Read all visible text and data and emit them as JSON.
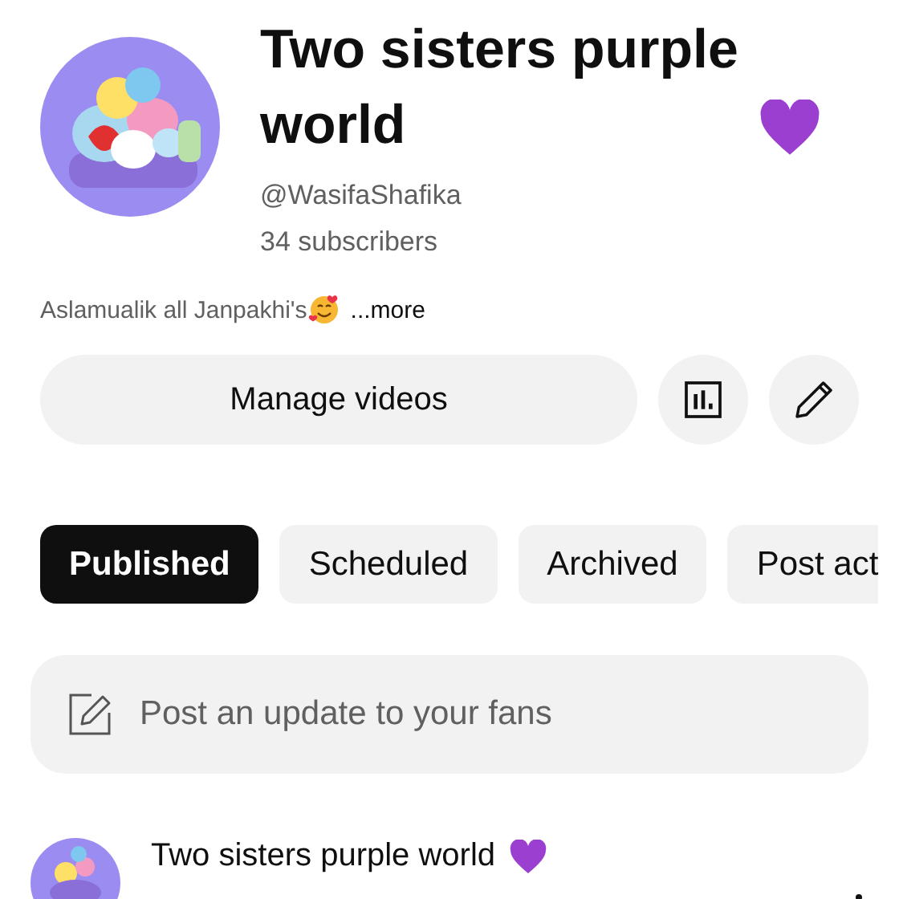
{
  "channel": {
    "title": "Two sisters purple world",
    "handle": "@WasifaShafika",
    "subscribers": "34 subscribers",
    "description": "Aslamualik all Janpakhi's",
    "more": "...more"
  },
  "actions": {
    "manage": "Manage videos"
  },
  "tabs": [
    {
      "label": "Published",
      "selected": true
    },
    {
      "label": "Scheduled",
      "selected": false
    },
    {
      "label": "Archived",
      "selected": false
    },
    {
      "label": "Post act",
      "selected": false
    }
  ],
  "composer": {
    "placeholder": "Post an update to your fans"
  },
  "posts": [
    {
      "author": "Two sisters purple world"
    }
  ]
}
